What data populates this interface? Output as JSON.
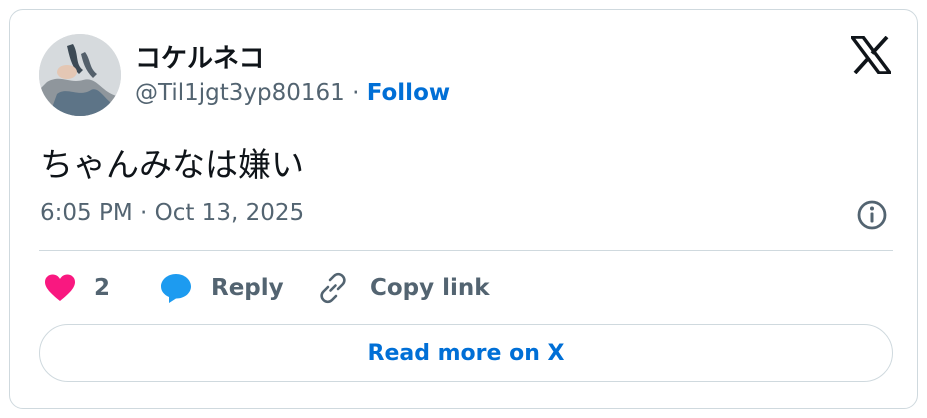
{
  "author": {
    "display_name": "コケルネコ",
    "handle": "@Til1jgt3yp80161",
    "separator": " · ",
    "follow_label": "Follow"
  },
  "tweet": {
    "text": "ちゃんみなは嫌い",
    "timestamp": "6:05 PM · Oct 13, 2025"
  },
  "actions": {
    "like_count": "2",
    "reply_label": "Reply",
    "copy_label": "Copy link"
  },
  "read_more_label": "Read more on X",
  "icons": {
    "brand": "x-logo-icon",
    "info": "info-icon",
    "like": "heart-icon",
    "reply": "reply-bubble-icon",
    "copy": "link-icon"
  },
  "colors": {
    "follow": "#006fd6",
    "like": "#f91880",
    "reply": "#1d9bf0",
    "text": "#0f1419",
    "muted": "#536471",
    "border": "#cfd9de"
  }
}
